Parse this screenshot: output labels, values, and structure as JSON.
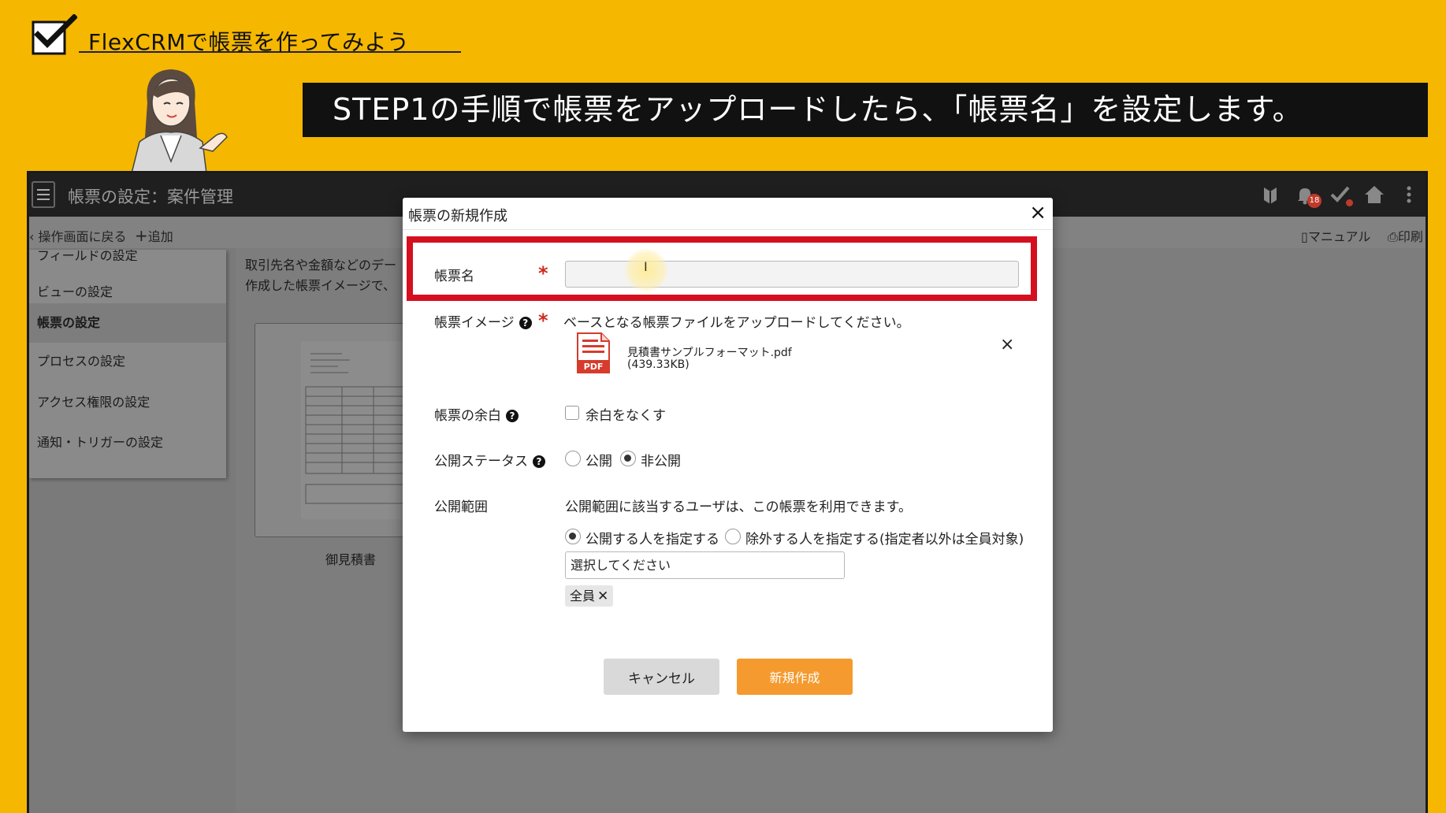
{
  "overlay": {
    "brand_title": "FlexCRMで帳票を作ってみよう",
    "step_text": "STEP1の手順で帳票をアップロードしたら、「帳票名」を設定します。"
  },
  "app": {
    "title": "帳票の設定：案件管理",
    "notification_count": "18",
    "toolbar": {
      "back": "操作画面に戻る",
      "add": "追加",
      "manual": "マニュアル",
      "print": "印刷"
    },
    "sidebar": {
      "items": [
        {
          "label": "フィールドの設定"
        },
        {
          "label": "ビューの設定"
        },
        {
          "label": "帳票の設定"
        },
        {
          "label": "プロセスの設定"
        },
        {
          "label": "アクセス権限の設定"
        },
        {
          "label": "通知・トリガーの設定"
        }
      ]
    },
    "content": {
      "desc1": "取引先名や金額などのデー",
      "desc2": "作成した帳票イメージで、",
      "template_caption": "御見積書"
    }
  },
  "modal": {
    "title": "帳票の新規作成",
    "close": "×",
    "name_label": "帳票名",
    "name_value": "",
    "required_mark": "*",
    "image_label": "帳票イメージ",
    "image_hint": "ベースとなる帳票ファイルをアップロードしてください。",
    "file_name": "見積書サンプルフォーマット.pdf",
    "file_size": "(439.33KB)",
    "file_remove": "×",
    "margin_label": "帳票の余白",
    "margin_option": "余白をなくす",
    "status_label": "公開ステータス",
    "status_options": [
      "公開",
      "非公開"
    ],
    "status_selected": "非公開",
    "scope_label": "公開範囲",
    "scope_desc": "公開範囲に該当するユーザは、この帳票を利用できます。",
    "scope_options": [
      "公開する人を指定する",
      "除外する人を指定する(指定者以外は全員対象)"
    ],
    "scope_selected": "公開する人を指定する",
    "select_placeholder": "選択してください",
    "tag": "全員",
    "cancel": "キャンセル",
    "create": "新規作成"
  },
  "icons": {
    "brand": "checkbox-check-icon",
    "pdf": "pdf-file-icon",
    "header": [
      "beginner-mark-icon",
      "bell-icon",
      "check-icon",
      "home-icon",
      "more-vertical-icon"
    ]
  },
  "colors": {
    "background": "#F5B700",
    "highlight": "#d4101f",
    "primary_button": "#F59A2E",
    "required": "#d02a20"
  }
}
